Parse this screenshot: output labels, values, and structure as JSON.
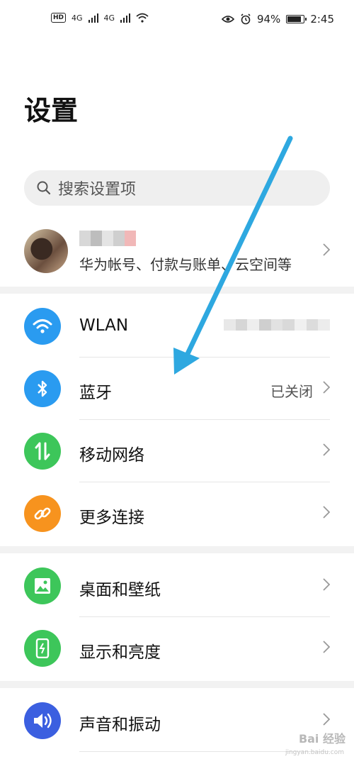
{
  "status_bar": {
    "left_network": [
      "4G",
      "4G"
    ],
    "battery": "94%",
    "battery_level": 0.94,
    "time": "2:45"
  },
  "header": {
    "title": "设置"
  },
  "search": {
    "placeholder": "搜索设置项"
  },
  "account": {
    "subtitle": "华为帐号、付款与账单、云空间等"
  },
  "groups": [
    [
      {
        "label": "WLAN",
        "icon": "wifi-icon",
        "color": "#2a9bf0",
        "value": ""
      },
      {
        "label": "蓝牙",
        "icon": "bluetooth-icon",
        "color": "#2a9bf0",
        "value": "已关闭"
      },
      {
        "label": "移动网络",
        "icon": "mobile-data-icon",
        "color": "#3dc65a",
        "value": ""
      },
      {
        "label": "更多连接",
        "icon": "link-icon",
        "color": "#f7931e",
        "value": ""
      }
    ],
    [
      {
        "label": "桌面和壁纸",
        "icon": "image-icon",
        "color": "#3dc65a",
        "value": ""
      },
      {
        "label": "显示和亮度",
        "icon": "phone-brightness-icon",
        "color": "#3dc65a",
        "value": ""
      }
    ],
    [
      {
        "label": "声音和振动",
        "icon": "speaker-icon",
        "color": "#3b5fe0",
        "value": ""
      }
    ]
  ],
  "annotation": {
    "arrow_color": "#2ea8e0"
  },
  "watermark": {
    "brand": "Bai 经验",
    "url": "jingyan.baidu.com"
  }
}
